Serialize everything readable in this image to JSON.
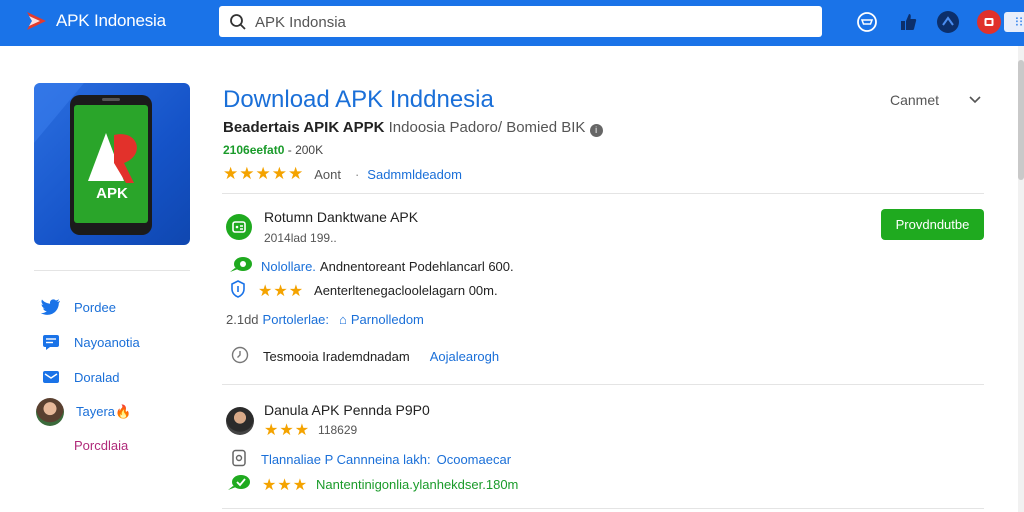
{
  "topbar": {
    "brand": "APK Indonesia",
    "search_value": "APK Indonsia",
    "search_more": "⁝⁝"
  },
  "app": {
    "title": "Download APK Inddnesia",
    "developer": "Beadertais APIK APPK",
    "developer_tail": "Indoosia Padoro/ Bomied BIK",
    "meta_version": "2106eefat0",
    "meta_size": "200K",
    "rating": 5,
    "rating_text": "Aont",
    "rating_link": "Sadmmldeadom",
    "icon_label": "APK",
    "cancel_label": "Canmet"
  },
  "sidebar": {
    "items": [
      {
        "label": "Pordee",
        "icon": "twitter-bird-icon"
      },
      {
        "label": "Nayoanotia",
        "icon": "message-icon"
      },
      {
        "label": "Doralad",
        "icon": "mail-icon"
      },
      {
        "label": "Tayera",
        "icon": "avatar"
      }
    ],
    "extra": "Porcdlaia"
  },
  "section1": {
    "title": "Rotumn Danktwane APK",
    "subtitle": "2014lad 199..",
    "download_button": "Provdndutbe",
    "line1_blue": "Nolollare.",
    "line1_text": "Andnentoreant Podehlancarl 600.",
    "line2_stars": 3,
    "line2_text": "Aenterltenegacloolelagarn 00m.",
    "line3_prefix": "2.1dd",
    "line3_blue": "Portolerlae:",
    "line3_link": "Parnolledom",
    "line4_text": "Tesmooia Irademdnadam",
    "line4_link": "Aojalearogh"
  },
  "section2": {
    "title": "Danula APK Pennda P9P0",
    "stars": 3,
    "stars_text": "118629",
    "line1_blue": "Tlannaliae P Cannneina lakh:",
    "line1_link": "Ocoomaecar",
    "line2_stars": 3,
    "line2_text": "Nantentinigonlia.ylanhekdser.180m"
  },
  "colors": {
    "topbar": "#1a73e8",
    "link": "#1a6fd8",
    "green": "#1faa1f",
    "star": "#f4a300"
  }
}
